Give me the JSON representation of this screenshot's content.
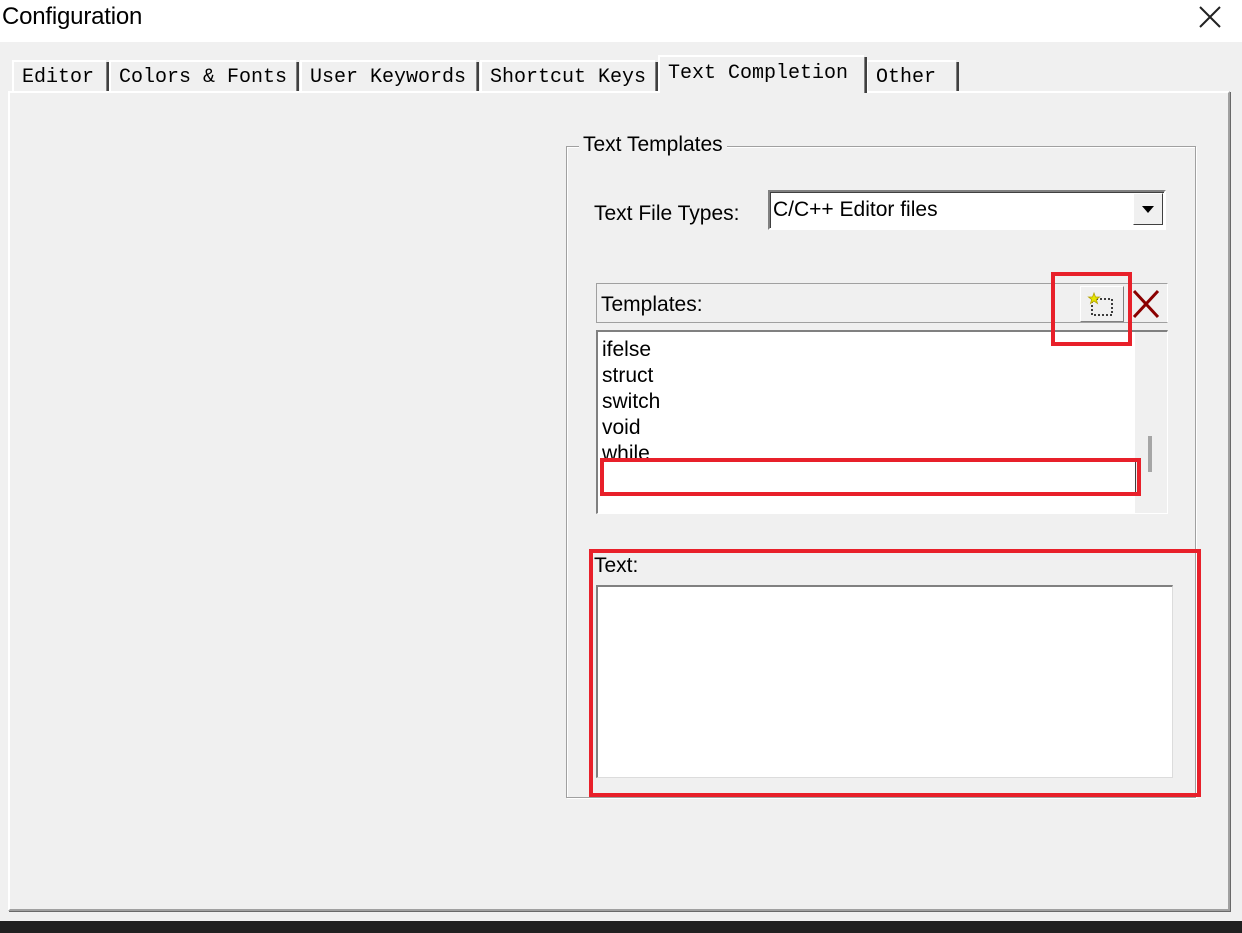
{
  "window": {
    "title": "Configuration",
    "close_icon": "close-icon"
  },
  "tabs": [
    {
      "label": "Editor",
      "active": false
    },
    {
      "label": "Colors & Fonts",
      "active": false
    },
    {
      "label": "User Keywords",
      "active": false
    },
    {
      "label": "Shortcut Keys",
      "active": false
    },
    {
      "label": "Text Completion",
      "active": true
    },
    {
      "label": "Other",
      "active": false
    }
  ],
  "text_templates": {
    "group_title": "Text Templates",
    "file_types_label": "Text File Types:",
    "file_types_value": "C/C++ Editor files",
    "templates_label": "Templates:",
    "new_icon": "new-item-icon",
    "delete_icon": "delete-x-icon",
    "templates": [
      "ifelse",
      "struct",
      "switch",
      "void",
      "while"
    ],
    "new_template_value": "",
    "text_label": "Text:",
    "text_value": ""
  },
  "colors": {
    "highlight": "#e8202a",
    "delete_x": "#8b0000",
    "background": "#f0f0f0"
  }
}
